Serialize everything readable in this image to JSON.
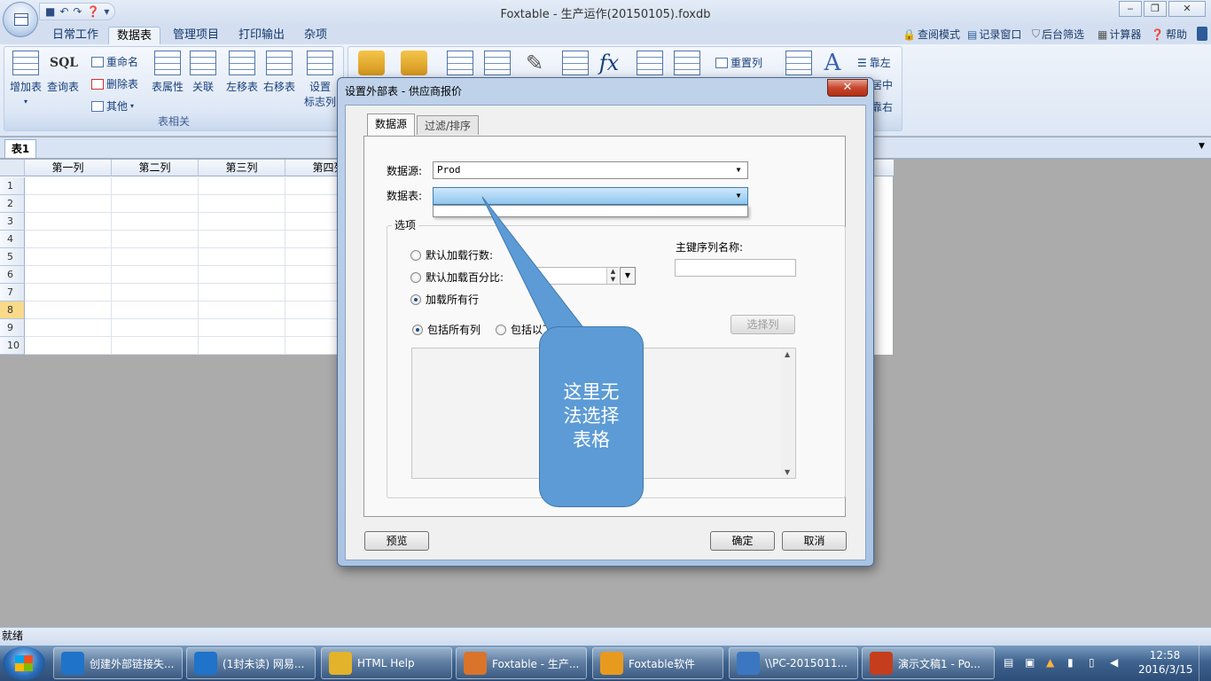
{
  "window": {
    "title": "Foxtable - 生产运作(20150105).foxdb",
    "min": "‒",
    "max": "❐",
    "close": "✕"
  },
  "ribbon_tabs": [
    "日常工作",
    "数据表",
    "管理项目",
    "打印输出",
    "杂项"
  ],
  "ribbon_links": [
    "查阅模式",
    "记录窗口",
    "后台筛选",
    "计算器",
    "帮助"
  ],
  "ribbon": {
    "add_table": "增加表",
    "sql_label": "SQL",
    "query_table": "查询表",
    "rename": "重命名",
    "delete_table": "删除表",
    "other": "其他",
    "table_props": "表属性",
    "relation": "关联",
    "move_left": "左移表",
    "move_right": "右移表",
    "set_flag_line1": "设置",
    "set_flag_line2": "标志列",
    "group_label": "表相关",
    "reset_cols": "重置列",
    "align_left": "靠左",
    "align_center": "居中",
    "align_right": "靠右"
  },
  "sheet": {
    "tab": "表1",
    "columns": [
      "第一列",
      "第二列",
      "第三列",
      "第四列"
    ],
    "rows": [
      "1",
      "2",
      "3",
      "4",
      "5",
      "6",
      "7",
      "8",
      "9",
      "10"
    ],
    "selected_row": "8"
  },
  "status_text": "就绪",
  "dialog": {
    "title": "设置外部表 - 供应商报价",
    "close": "✕",
    "tabs": [
      "数据源",
      "过滤/排序"
    ],
    "datasource_label": "数据源:",
    "datasource_value": "Prod",
    "table_label": "数据表:",
    "table_value": "",
    "options_legend": "选项",
    "radio_rows": "默认加载行数:",
    "radio_percent": "默认加载百分比:",
    "radio_all_rows": "加载所有行",
    "pk_label": "主键序列名称:",
    "pk_value": "",
    "include_all_cols": "包括所有列",
    "include_following": "包括以下",
    "select_cols": "选择列",
    "preview": "预览",
    "ok": "确定",
    "cancel": "取消"
  },
  "callout_text": "这里无法选择表格",
  "taskbar": {
    "items": [
      {
        "label": "创建外部链接失...",
        "icon": "ie-icon",
        "color": "#1f73c8"
      },
      {
        "label": "(1封未读) 网易...",
        "icon": "ie-icon",
        "color": "#1f73c8"
      },
      {
        "label": "HTML Help",
        "icon": "help-icon",
        "color": "#e2b32b"
      },
      {
        "label": "Foxtable - 生产...",
        "icon": "foxtable-icon",
        "color": "#d9742a"
      },
      {
        "label": "Foxtable软件",
        "icon": "foxtable-web-icon",
        "color": "#e89a1f"
      },
      {
        "label": "\\\\PC-2015011...",
        "icon": "remote-desktop-icon",
        "color": "#3b77c0"
      },
      {
        "label": "演示文稿1 - Po...",
        "icon": "powerpoint-icon",
        "color": "#c43e1c"
      }
    ],
    "time": "12:58",
    "date": "2016/3/15"
  }
}
